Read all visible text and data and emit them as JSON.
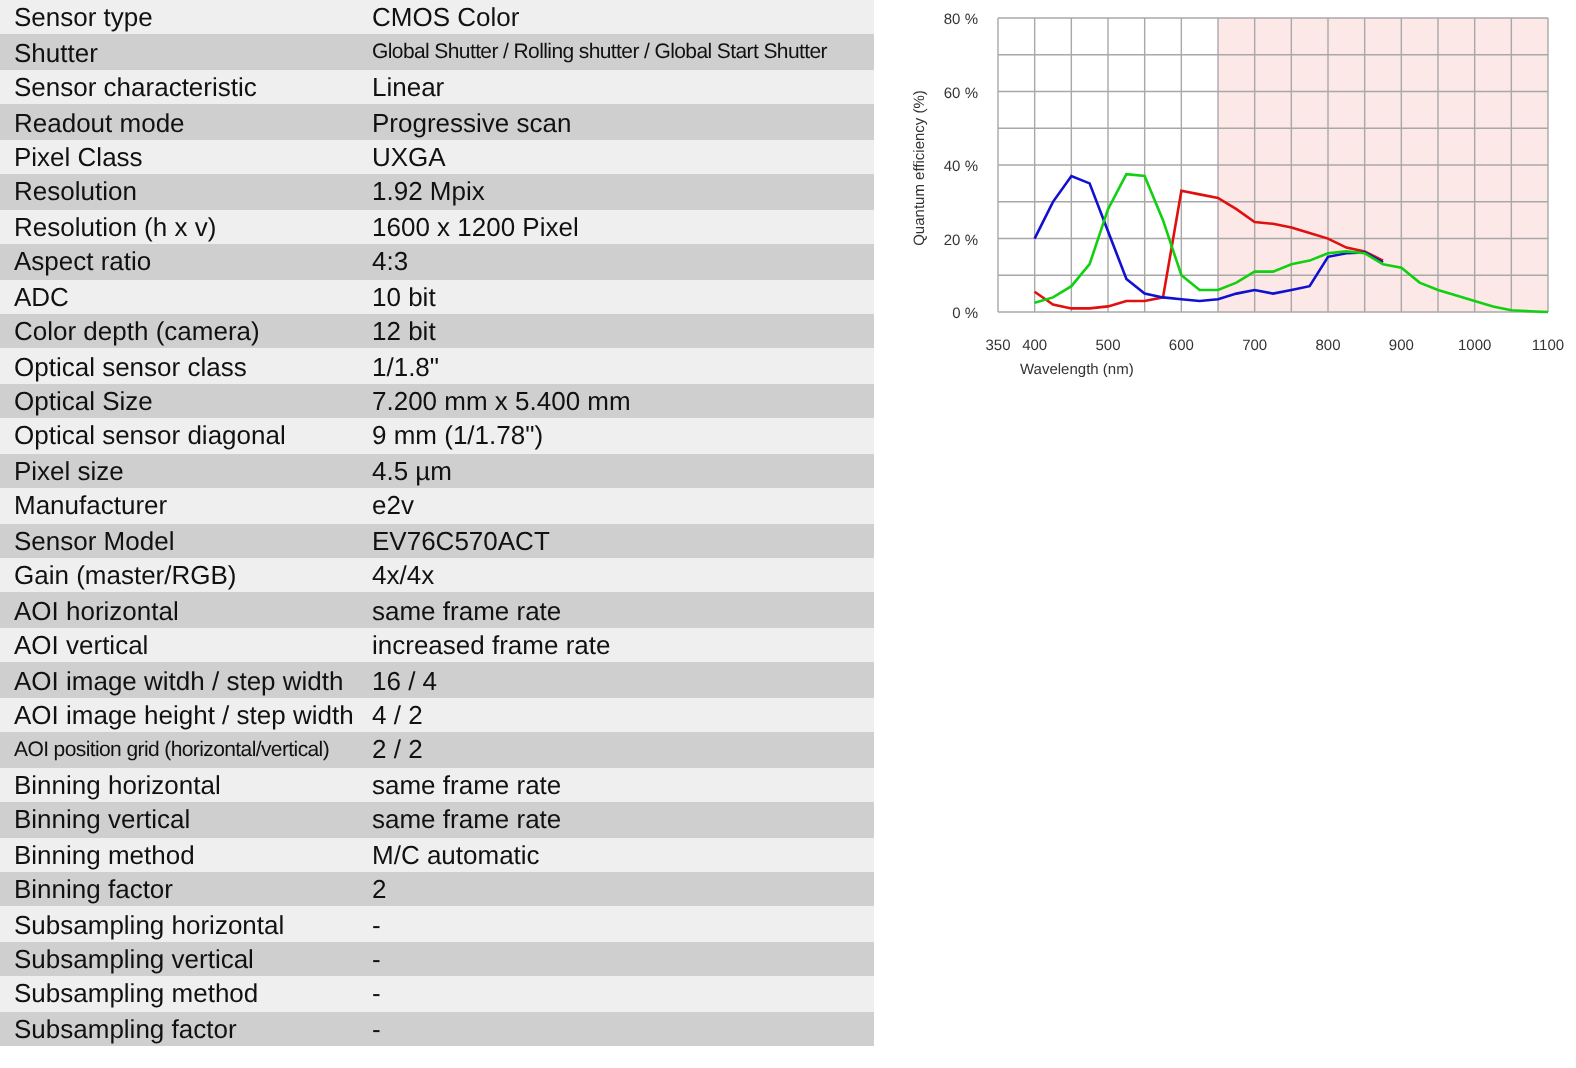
{
  "spec_table": {
    "rows": [
      {
        "label": "Sensor type",
        "value": "CMOS Color"
      },
      {
        "label": "Shutter",
        "value": "Global Shutter / Rolling shutter / Global Start Shutter"
      },
      {
        "label": "Sensor characteristic",
        "value": "Linear"
      },
      {
        "label": "Readout mode",
        "value": "Progressive scan"
      },
      {
        "label": "Pixel Class",
        "value": "UXGA"
      },
      {
        "label": "Resolution",
        "value": "1.92 Mpix"
      },
      {
        "label": "Resolution (h x v)",
        "value": "1600 x 1200 Pixel"
      },
      {
        "label": "Aspect ratio",
        "value": "4:3"
      },
      {
        "label": "ADC",
        "value": "10 bit"
      },
      {
        "label": "Color depth (camera)",
        "value": "12 bit"
      },
      {
        "label": "Optical sensor class",
        "value": "1/1.8\""
      },
      {
        "label": "Optical Size",
        "value": "7.200 mm x 5.400 mm"
      },
      {
        "label": "Optical sensor diagonal",
        "value": "9 mm (1/1.78\")"
      },
      {
        "label": "Pixel size",
        "value": "4.5 µm"
      },
      {
        "label": "Manufacturer",
        "value": "e2v"
      },
      {
        "label": "Sensor Model",
        "value": "EV76C570ACT"
      },
      {
        "label": "Gain (master/RGB)",
        "value": "4x/4x"
      },
      {
        "label": "AOI horizontal",
        "value": "same frame rate"
      },
      {
        "label": "AOI vertical",
        "value": "increased frame rate"
      },
      {
        "label": "AOI image witdh / step width",
        "value": "16 / 4"
      },
      {
        "label": "AOI image height / step width",
        "value": "4 / 2"
      },
      {
        "label": "AOI position grid (horizontal/vertical)",
        "value": "2 / 2"
      },
      {
        "label": "Binning horizontal",
        "value": "same frame rate"
      },
      {
        "label": "Binning vertical",
        "value": "same frame rate"
      },
      {
        "label": "Binning method",
        "value": "M/C automatic"
      },
      {
        "label": "Binning factor",
        "value": "2"
      },
      {
        "label": "Subsampling horizontal",
        "value": "-"
      },
      {
        "label": "Subsampling vertical",
        "value": "-"
      },
      {
        "label": "Subsampling method",
        "value": "-"
      },
      {
        "label": "Subsampling factor",
        "value": "-"
      }
    ]
  },
  "spectral_chart": {
    "chart_data": {
      "type": "line",
      "xlabel": "Wavelength (nm)",
      "ylabel": "Quantum efficiency (%)",
      "x": [
        400,
        425,
        450,
        475,
        500,
        525,
        550,
        575,
        600,
        625,
        650,
        675,
        700,
        725,
        750,
        775,
        800,
        825,
        850,
        875,
        900,
        925,
        950,
        975,
        1000,
        1025,
        1050,
        1075,
        1100
      ],
      "series": [
        {
          "color": "#e01010",
          "values": [
            5.5,
            2,
            1,
            1,
            1.5,
            3,
            3,
            4,
            33,
            32,
            31,
            28,
            24.5,
            24,
            23,
            21.5,
            20,
            17.5,
            16.5,
            14,
            null,
            null,
            null,
            null,
            null,
            null,
            null,
            null,
            null
          ]
        },
        {
          "color": "#1010d0",
          "values": [
            20,
            30,
            37,
            35,
            22,
            9,
            5,
            4,
            3.5,
            3,
            3.5,
            5,
            6,
            5,
            6,
            7,
            15,
            16,
            16.2,
            13.5,
            null,
            null,
            null,
            null,
            null,
            null,
            null,
            null,
            null
          ]
        },
        {
          "color": "#10d010",
          "values": [
            2.5,
            4,
            7,
            13,
            28,
            37.5,
            37,
            25,
            10,
            6,
            6,
            8,
            11,
            11,
            13,
            14,
            16,
            16.5,
            16,
            13,
            12,
            8,
            6,
            4.5,
            3,
            1.5,
            0.5,
            0.2,
            0
          ]
        }
      ],
      "grid": true,
      "bands": [
        {
          "axis": "x",
          "from": 650,
          "to": 1100
        }
      ],
      "xlim": [
        350,
        1100
      ],
      "ylim": [
        0,
        80
      ],
      "xticks": [
        350,
        400,
        500,
        600,
        700,
        800,
        900,
        1000,
        1100
      ],
      "yticks": [
        {
          "value": 0,
          "label": "0 %"
        },
        {
          "value": 20,
          "label": "20 %"
        },
        {
          "value": 40,
          "label": "40 %"
        },
        {
          "value": 60,
          "label": "60 %"
        },
        {
          "value": 80,
          "label": "80 %"
        }
      ]
    }
  }
}
